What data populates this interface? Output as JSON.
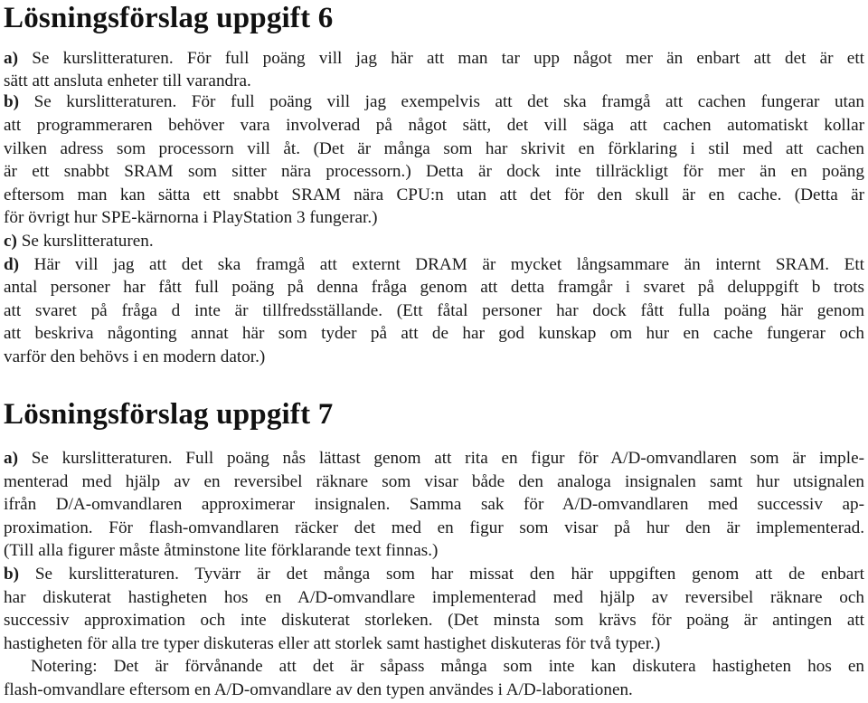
{
  "sections": [
    {
      "title": "Lösningsförslag uppgift 6",
      "lines": [
        {
          "label": "a)",
          "text": " Se kurslitteraturen. För full poäng vill jag här att man tar upp något mer än enbart att det är ett"
        },
        {
          "label": "",
          "text": "sätt att ansluta enheter till varandra."
        },
        {
          "label": "b)",
          "text": " Se kurslitteraturen. För full poäng vill jag exempelvis att det ska framgå att cachen fungerar utan"
        },
        {
          "label": "",
          "text": "att programmeraren behöver vara involverad på något sätt, det vill säga att cachen automatiskt kollar"
        },
        {
          "label": "",
          "text": "vilken adress som processorn vill åt. (Det är många som har skrivit en förklaring i stil med att cachen"
        },
        {
          "label": "",
          "text": "är ett snabbt SRAM som sitter nära processorn.) Detta är dock inte tillräckligt för mer än en poäng"
        },
        {
          "label": "",
          "text": "eftersom man kan sätta ett snabbt SRAM nära CPU:n utan att det för den skull är en cache. (Detta är"
        },
        {
          "label": "",
          "text": "för övrigt hur SPE-kärnorna i PlayStation 3 fungerar.)"
        },
        {
          "label": "c)",
          "text": " Se kurslitteraturen."
        },
        {
          "label": "d)",
          "text": " Här vill jag att det ska framgå att externt DRAM är mycket långsammare än internt SRAM. Ett"
        },
        {
          "label": "",
          "text": "antal personer har fått full poäng på denna fråga genom att detta framgår i svaret på deluppgift b trots"
        },
        {
          "label": "",
          "text": "att svaret på fråga d inte är tillfredsställande. (Ett fåtal personer har dock fått fulla poäng här genom"
        },
        {
          "label": "",
          "text": "att beskriva någonting annat här som tyder på att de har god kunskap om hur en cache fungerar och"
        },
        {
          "label": "",
          "text": "varför den behövs i en modern dator.)"
        }
      ]
    },
    {
      "title": "Lösningsförslag uppgift 7",
      "lines": [
        {
          "label": "a)",
          "text": " Se kurslitteraturen. Full poäng nås lättast genom att rita en figur för A/D-omvandlaren som är imple-"
        },
        {
          "label": "",
          "text": "menterad med hjälp av en reversibel räknare som visar både den analoga insignalen samt hur utsignalen"
        },
        {
          "label": "",
          "text": "ifrån D/A-omvandlaren approximerar insignalen. Samma sak för A/D-omvandlaren med successiv ap-"
        },
        {
          "label": "",
          "text": "proximation. För flash-omvandlaren räcker det med en figur som visar på hur den är implementerad."
        },
        {
          "label": "",
          "text": "(Till alla figurer måste åtminstone lite förklarande text finnas.)"
        },
        {
          "label": "b)",
          "text": " Se kurslitteraturen. Tyvärr är det många som har missat den här uppgiften genom att de enbart"
        },
        {
          "label": "",
          "text": "har diskuterat hastigheten hos en A/D-omvandlare implementerad med hjälp av reversibel räknare och"
        },
        {
          "label": "",
          "text": "successiv approximation och inte diskuterat storleken. (Det minsta som krävs för poäng är antingen att"
        },
        {
          "label": "",
          "text": "hastigheten för alla tre typer diskuteras eller att storlek samt hastighet diskuteras för två typer.)"
        },
        {
          "label": "",
          "text": "Notering: Det är förvånande att det är såpass många som inte kan diskutera hastigheten hos en"
        },
        {
          "label": "",
          "text": "flash-omvandlare eftersom en A/D-omvandlare av den typen användes i A/D-laborationen."
        }
      ]
    }
  ]
}
